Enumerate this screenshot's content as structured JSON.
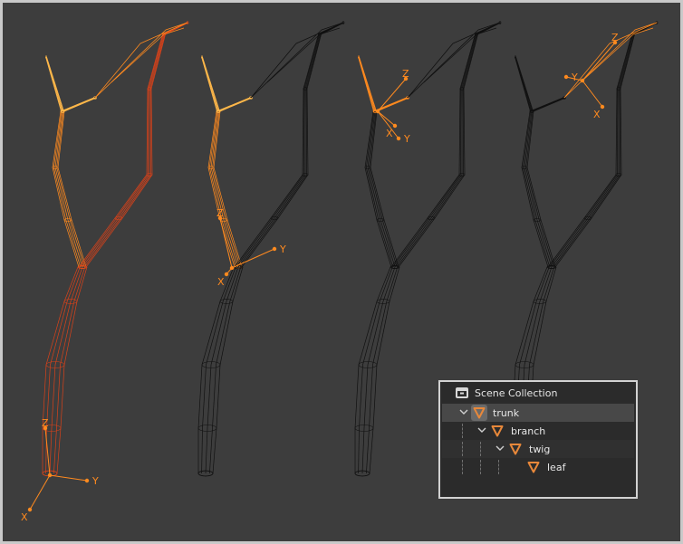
{
  "viewport": {
    "axis_labels": {
      "x": "X",
      "y": "Y",
      "z": "Z"
    },
    "colors": {
      "background": "#3d3d3d",
      "wire_dark": "#111111",
      "selected_orange": "#ff8a1f",
      "selected_red": "#d9421a",
      "active_yellow": "#ffb84a"
    }
  },
  "outliner": {
    "header_label": "Scene Collection",
    "items": [
      {
        "label": "trunk",
        "depth": 0,
        "expanded": true,
        "active": true
      },
      {
        "label": "branch",
        "depth": 1,
        "expanded": true
      },
      {
        "label": "twig",
        "depth": 2,
        "expanded": true
      },
      {
        "label": "leaf",
        "depth": 3,
        "expanded": false
      }
    ],
    "colors": {
      "panel_bg": "#2b2b2b",
      "active_row": "#484848",
      "icon_orange": "#e8883a",
      "text": "#e6e6e6"
    }
  }
}
